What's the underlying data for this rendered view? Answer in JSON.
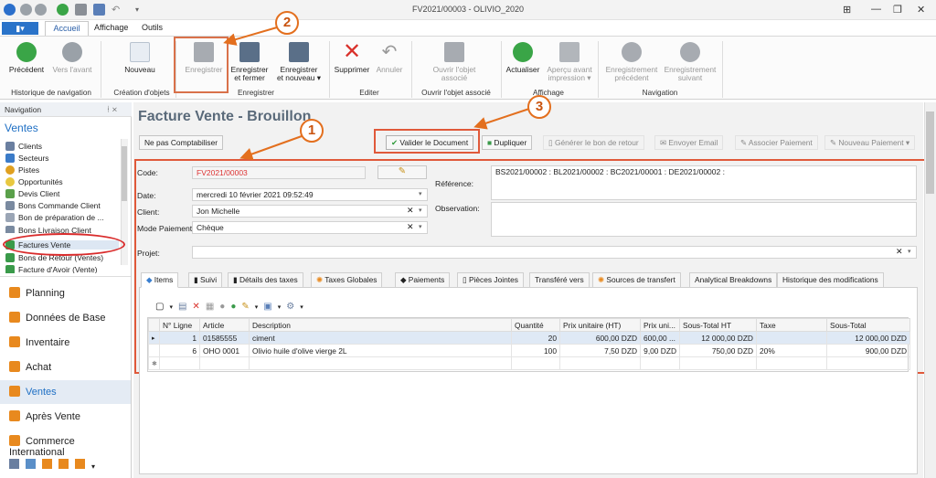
{
  "window": {
    "title": "FV2021/00003 - OLIVIO_2020"
  },
  "tabs": {
    "file": "▮▾",
    "home": "Accueil",
    "display": "Affichage",
    "tools": "Outils"
  },
  "ribbon": {
    "previous": "Précédent",
    "forward": "Vers l'avant",
    "nav_history": "Historique de navigation",
    "new": "Nouveau",
    "creation": "Création d'objets",
    "save": "Enregistrer",
    "save_close_1": "Enregistrer",
    "save_close_2": "et fermer",
    "save_new_1": "Enregistrer",
    "save_new_2": "et nouveau ▾",
    "save_group": "Enregistrer",
    "delete": "Supprimer",
    "cancel": "Annuler",
    "edit_group": "Editer",
    "open_assoc_1": "Ouvrir l'objet",
    "open_assoc_2": "associé",
    "open_assoc_group": "Ouvrir l'objet associé",
    "refresh": "Actualiser",
    "print_preview_1": "Aperçu avant",
    "print_preview_2": "impression ▾",
    "display_group": "Affichage",
    "prev_record_1": "Enregistrement",
    "prev_record_2": "précédent",
    "next_record_1": "Enregistrement",
    "next_record_2": "suivant",
    "navigation_group": "Navigation"
  },
  "nav": {
    "header": "Navigation",
    "pin": "ᚽ ✕",
    "section": "Ventes",
    "items": [
      "Clients",
      "Secteurs",
      "Pistes",
      "Opportunités",
      "Devis Client",
      "Bons Commande Client",
      "Bon de préparation de ...",
      "Bons Livraison Client",
      "Factures Vente",
      "Bons de Retour (Ventes)",
      "Facture d'Avoir (Vente)"
    ],
    "modules": [
      "Planning",
      "Données de Base",
      "Inventaire",
      "Achat",
      "Ventes",
      "Après Vente",
      "Commerce International"
    ]
  },
  "doc": {
    "title": "Facture Vente - Brouillon",
    "buttons": {
      "no_account": "Ne pas Comptabiliser",
      "validate": "Valider le Document",
      "duplicate": "Dupliquer",
      "return": "Générer le bon de retour",
      "email": "Envoyer Email",
      "payment": "Associer Paiement",
      "new_payment": "Nouveau Paiement"
    },
    "labels": {
      "code": "Code:",
      "date": "Date:",
      "client": "Client:",
      "mode": "Mode Paiement:",
      "project": "Projet:",
      "reference": "Référence:",
      "observation": "Observation:"
    },
    "values": {
      "code": "FV2021/00003",
      "date": "mercredi 10 février 2021 09:52:49",
      "client": "Jon Michelle",
      "mode": "Chèque",
      "project": "",
      "reference": "BS2021/00002 : BL2021/00002 : BC2021/00001 : DE2021/00002 :",
      "observation": ""
    }
  },
  "subtabs": [
    "Items",
    "Suivi",
    "Détails des taxes",
    "Taxes Globales",
    "Paiements",
    "Pièces Jointes",
    "Transféré vers",
    "Sources de transfert",
    "Analytical Breakdowns",
    "Historique des modifications"
  ],
  "grid": {
    "headers": [
      "N° Ligne",
      "Article",
      "Description",
      "Quantité",
      "Prix unitaire (HT)",
      "Prix uni...",
      "Sous-Total HT",
      "Taxe",
      "Sous-Total"
    ],
    "rows": [
      [
        "1",
        "01585555",
        "ciment",
        "20",
        "600,00 DZD",
        "600,00 ...",
        "12 000,00 DZD",
        "",
        "12 000,00 DZD"
      ],
      [
        "6",
        "OHO 0001",
        "Olivio huile d'olive vierge 2L",
        "100",
        "7,50 DZD",
        "9,00 DZD",
        "750,00 DZD",
        "20%",
        "900,00 DZD"
      ]
    ]
  },
  "callouts": [
    "1",
    "2",
    "3"
  ]
}
